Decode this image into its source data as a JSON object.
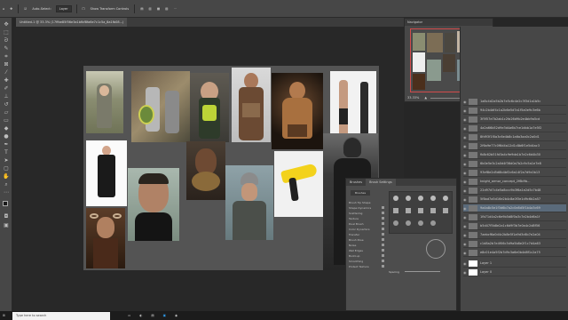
{
  "app": {
    "accent": "#31a8ff"
  },
  "options_bar": {
    "auto_select_label": "Auto-Select:",
    "auto_select_value": "Layer",
    "transform_label": "Show Transform Controls"
  },
  "document_tab": {
    "title": "Untitled-1 @ 33.3% (17ffbe85f56e3a1bfbf8fa6e7c1c5a_8a1fb08...)"
  },
  "navigator": {
    "title": "Navigator",
    "zoom": "33.33%"
  },
  "layers": {
    "items": [
      {
        "name": "1a8c4d2a5b2b7e5c6c4e2c3f3d1a1b5c"
      },
      {
        "name": "94c2b4df4c1a2b6e5d7a1f5a0e9c3e6b"
      },
      {
        "name": "3f5f57e7b2ab1c2fa26d9b2e4bb9a5cd"
      },
      {
        "name": "4a2a66b52d9e3d4a6b7ce1dbb1a7e5f2"
      },
      {
        "name": "8fd93f1f0a3c6e4b8c1a6a3aa0c2a0d1"
      },
      {
        "name": "2f6a9e77c0f6d4a12d1c8b6f1e5d4ac3"
      },
      {
        "name": "fb8c62b51fd3a4c9e9da1b7e2c6d4b30"
      },
      {
        "name": "6b0e5e3c2a0d4f36d0a7b2c9c5a1e7e8"
      },
      {
        "name": "93ef8e2d5d8b4bf2c6a14f2a7d9c0b13"
      },
      {
        "name": "knight_armor_concept_2f6b9b..."
      },
      {
        "name": "22d97d7c4e5a8ccc9b3f6a1e2d5c7b48"
      },
      {
        "name": "5f8ad7a5d16e2b4c8a0f3e1d9c6b2a57"
      },
      {
        "name": "9a4a8c5e1f3d6b7a2c0e8d5f1b4a3c69"
      },
      {
        "name": "1fb71d4a2c6e9b5d8f0a3c7e2b4d6a1f"
      },
      {
        "name": "b5d47f5b8e2a1c6d9f3b7e0a4c2d8f56"
      },
      {
        "name": "7aebcf6a0d4c2b8e5f1a9d3c6b7e2a04"
      },
      {
        "name": "c1d8a2b7e4f06c3d9a5b8e2f1c7d4a63"
      },
      {
        "name": "e8c01e4a5f2b7d9c3a6e0b4d8f1c2a75"
      },
      {
        "name": "Layer 1"
      },
      {
        "name": "Layer 0"
      }
    ]
  },
  "brush_panel": {
    "tabs": [
      "Brushes",
      "Brush Settings"
    ],
    "brushes_button": "Brushes",
    "options": [
      "Brush Tip Shape",
      "Shape Dynamics",
      "Scattering",
      "Texture",
      "Dual Brush",
      "Color Dynamics",
      "Transfer",
      "Brush Pose",
      "Noise",
      "Wet Edges",
      "Build-up",
      "Smoothing",
      "Protect Texture"
    ],
    "spacing_label": "Spacing"
  },
  "taskbar": {
    "search_placeholder": "Type here to search"
  },
  "canvas_images": [
    {
      "name": "knight-in-armor"
    },
    {
      "name": "armored-knights-with-shields"
    },
    {
      "name": "warrior-with-braids"
    },
    {
      "name": "barbarian-warrior"
    },
    {
      "name": "muscular-tribal-warrior"
    },
    {
      "name": "runway-models"
    },
    {
      "name": "woman-in-black-coat"
    },
    {
      "name": "young-man-portrait"
    },
    {
      "name": "tribal-face-portrait"
    },
    {
      "name": "man-with-helmet"
    },
    {
      "name": "yellow-hair-dryer"
    },
    {
      "name": "dark-armored-figure"
    },
    {
      "name": "horned-mask-figure"
    }
  ]
}
